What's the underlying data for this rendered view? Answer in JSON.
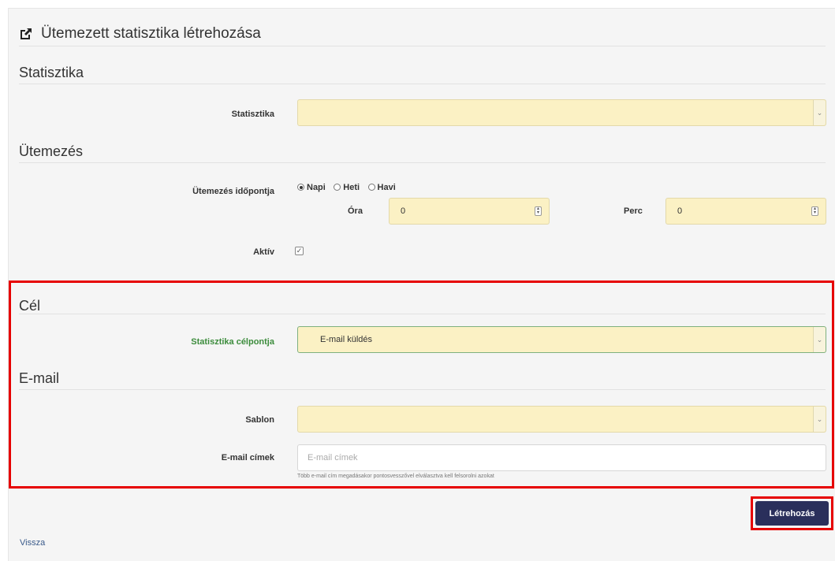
{
  "page": {
    "title": "Ütemezett statisztika létrehozása"
  },
  "sections": {
    "statisztika": "Statisztika",
    "utemezes": "Ütemezés",
    "cel": "Cél",
    "email": "E-mail"
  },
  "form": {
    "statisztika_label": "Statisztika",
    "statisztika_value": "",
    "utemezes_label": "Ütemezés időpontja",
    "radio_options": [
      "Napi",
      "Heti",
      "Havi"
    ],
    "radio_selected": "Napi",
    "ora_label": "Óra",
    "ora_value": "0",
    "perc_label": "Perc",
    "perc_value": "0",
    "aktiv_label": "Aktív",
    "aktiv_checked": true,
    "celpont_label": "Statisztika célpontja",
    "celpont_value": "E-mail küldés",
    "sablon_label": "Sablon",
    "sablon_value": "",
    "email_label": "E-mail címek",
    "email_placeholder": "E-mail címek",
    "email_help": "Több e-mail cím megadásakor pontosvesszővel elválasztva kell felsorolni azokat"
  },
  "actions": {
    "create_label": "Létrehozás",
    "back_label": "Vissza"
  },
  "colors": {
    "field_bg": "#fbf1c4",
    "button_bg": "#2a2f5b",
    "highlight": "#e60000",
    "valid_label": "#3c8c3c"
  },
  "icons": {
    "title_icon": "external-link-icon",
    "select_arrow": "chevron-down-icon",
    "spinner": "spinner-icon",
    "checkbox": "checkbox-icon"
  }
}
